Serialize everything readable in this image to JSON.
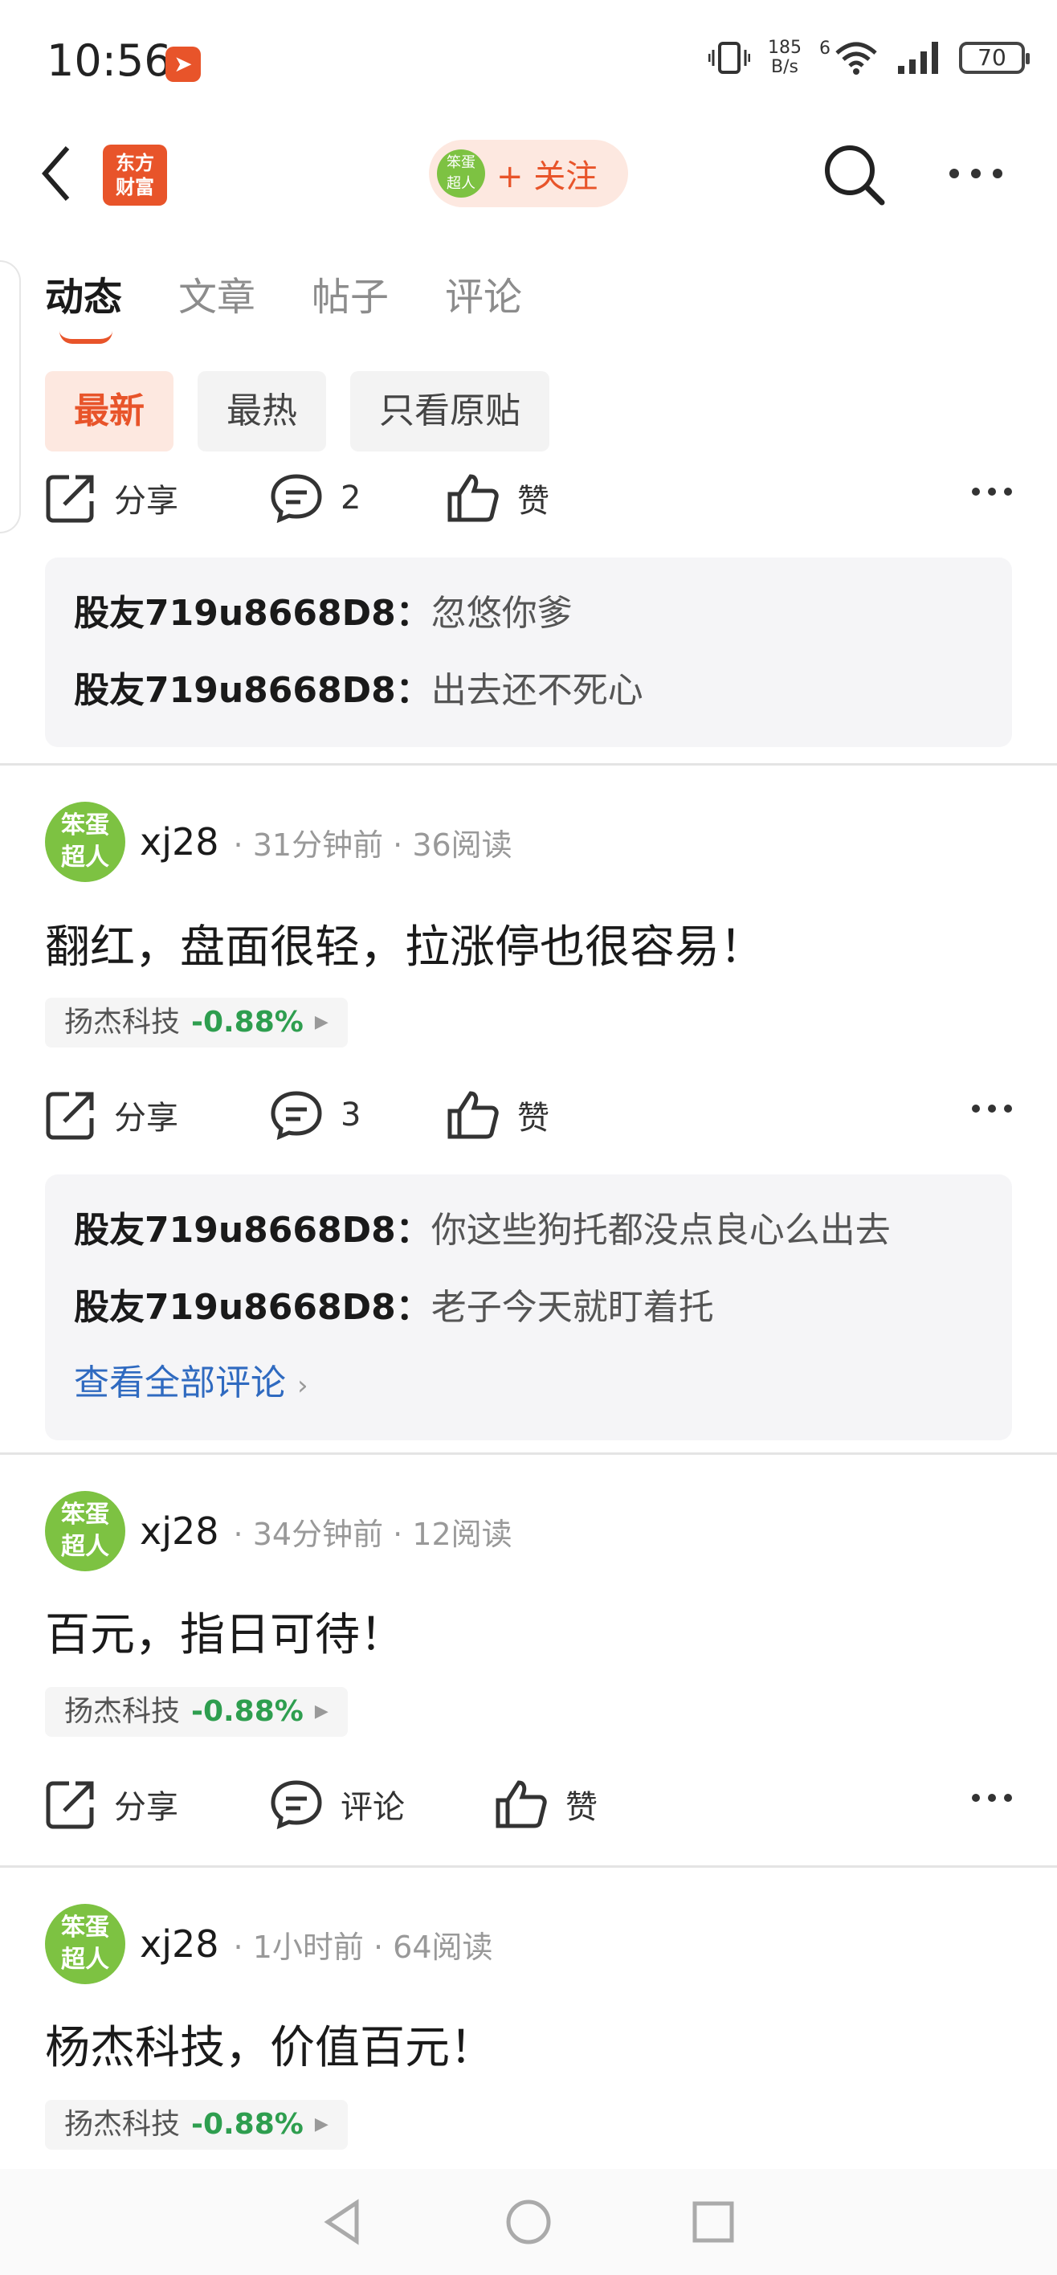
{
  "status_bar": {
    "time": "10:56",
    "net_speed_value": "185",
    "net_speed_unit": "B/s",
    "signal_label": "6",
    "battery": "70"
  },
  "nav": {
    "logo_text": "东方财富",
    "avatar_text": "笨蛋超人",
    "follow_label": "+ 关注"
  },
  "tabs": [
    {
      "label": "动态",
      "active": true
    },
    {
      "label": "文章",
      "active": false
    },
    {
      "label": "帖子",
      "active": false
    },
    {
      "label": "评论",
      "active": false
    }
  ],
  "filters": [
    {
      "label": "最新",
      "active": true
    },
    {
      "label": "最热",
      "active": false
    },
    {
      "label": "只看原贴",
      "active": false
    }
  ],
  "post0": {
    "share_label": "分享",
    "comment_count": "2",
    "like_label": "赞",
    "comments": [
      {
        "user": "股友719u8668D8：",
        "text": "忽悠你爹"
      },
      {
        "user": "股友719u8668D8：",
        "text": "出去还不死心"
      }
    ]
  },
  "post1": {
    "user": "xj28",
    "time": "31分钟前",
    "reads": "36阅读",
    "body": "翻红，盘面很轻，拉涨停也很容易！",
    "stock": {
      "name": "扬杰科技",
      "change": "-0.88%"
    },
    "share_label": "分享",
    "comment_count": "3",
    "like_label": "赞",
    "comments": [
      {
        "user": "股友719u8668D8：",
        "text": "你这些狗托都没点良心么出去"
      },
      {
        "user": "股友719u8668D8：",
        "text": "老子今天就盯着托"
      }
    ],
    "view_all": "查看全部评论"
  },
  "post2": {
    "user": "xj28",
    "time": "34分钟前",
    "reads": "12阅读",
    "body": "百元，指日可待！",
    "stock": {
      "name": "扬杰科技",
      "change": "-0.88%"
    },
    "share_label": "分享",
    "comment_label": "评论",
    "like_label": "赞"
  },
  "post3": {
    "user": "xj28",
    "time": "1小时前",
    "reads": "64阅读",
    "body": "杨杰科技，价值百元！",
    "stock": {
      "name": "扬杰科技",
      "change": "-0.88%"
    }
  },
  "colors": {
    "accent": "#e8542a",
    "positive_green": "#2e9e4f",
    "link_blue": "#2f6ac0",
    "avatar_green": "#7dc242"
  },
  "icons": [
    "app-notification-icon",
    "vibrate-icon",
    "wifi-icon",
    "signal-icon",
    "battery-icon",
    "back-icon",
    "search-icon",
    "more-icon",
    "share-icon",
    "comment-icon",
    "like-icon",
    "nav-back-icon",
    "nav-home-icon",
    "nav-recents-icon"
  ]
}
